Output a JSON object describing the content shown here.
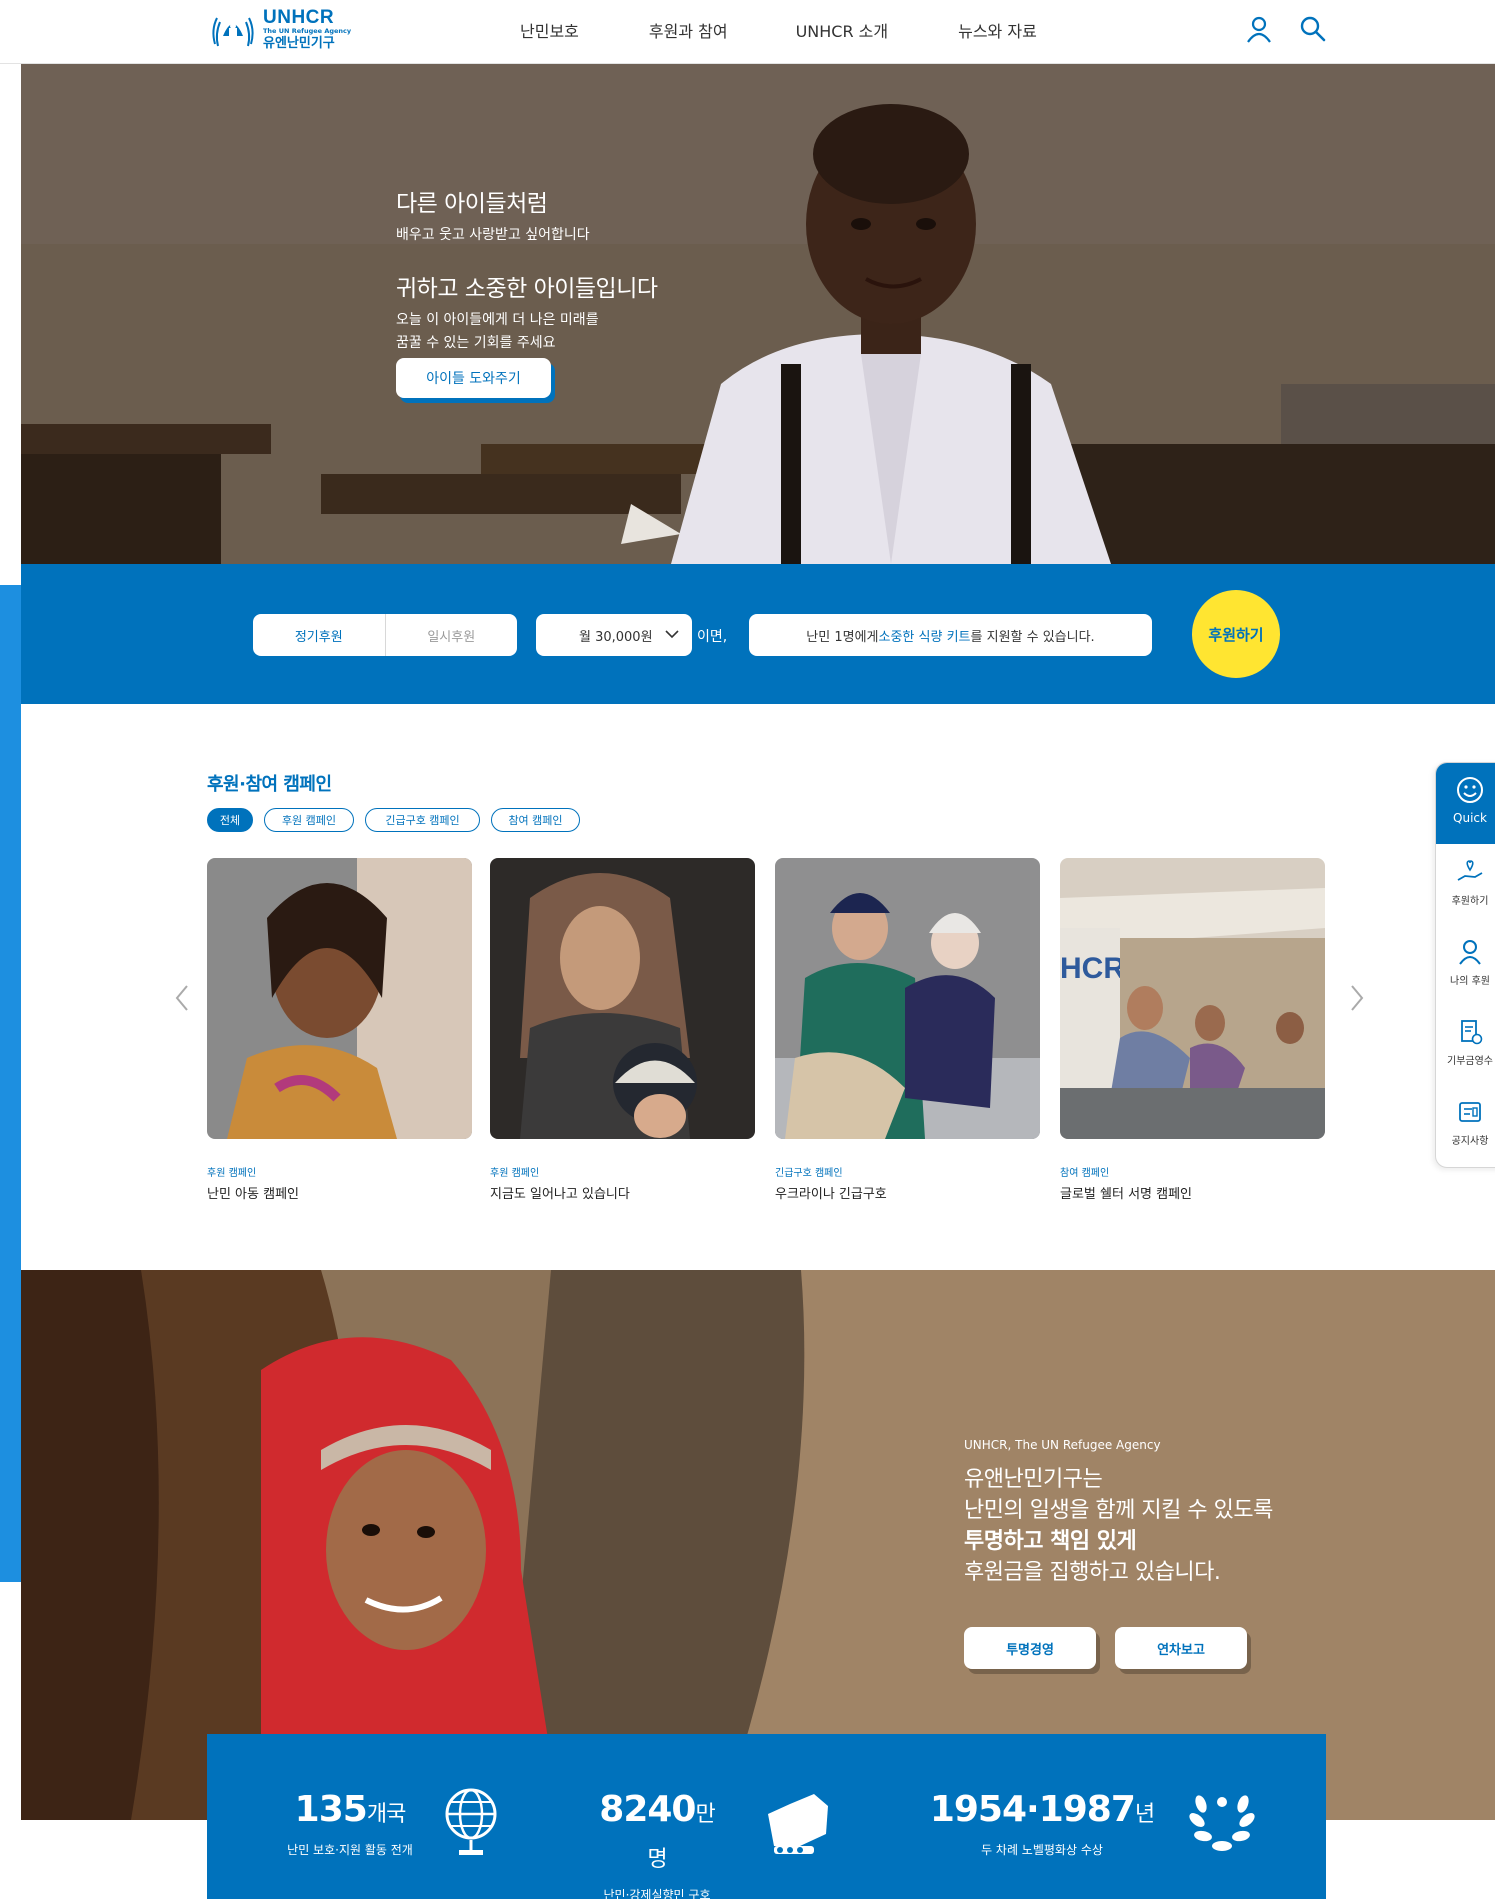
{
  "header": {
    "logo_name": "UNHCR",
    "logo_sub": "The UN Refugee Agency",
    "logo_korean": "유엔난민기구",
    "nav": [
      "난민보호",
      "후원과 참여",
      "UNHCR 소개",
      "뉴스와 자료"
    ],
    "icons": [
      "user-icon",
      "search-icon"
    ]
  },
  "hero": {
    "line1": "다른 아이들처럼",
    "line2": "배우고 웃고 사랑받고 싶어합니다",
    "line3": "귀하고 소중한 아이들입니다",
    "line4": "오늘 이 아이들에게 더 나은 미래를",
    "line5": "꿈꿀 수 있는 기회를 주세요",
    "button": "아이들 도와주기"
  },
  "donate": {
    "tab_regular": "정기후원",
    "tab_once": "일시후원",
    "amount": "월 30,000원",
    "if_text": "이면,",
    "msg_before": "난민 1명에게 ",
    "msg_highlight": "소중한 식량 키트",
    "msg_after": "를 지원할 수 있습니다.",
    "button": "후원하기"
  },
  "campaigns": {
    "title": "후원·참여 캠페인",
    "filters": [
      "전체",
      "후원 캠페인",
      "긴급구호 캠페인",
      "참여 캠페인"
    ],
    "cards": [
      {
        "category": "후원 캠페인",
        "title": "난민 아동 캠페인"
      },
      {
        "category": "후원 캠페인",
        "title": "지금도 일어나고 있습니다"
      },
      {
        "category": "긴급구호 캠페인",
        "title": "우크라이나 긴급구호"
      },
      {
        "category": "참여 캠페인",
        "title": "글로벌 쉘터 서명 캠페인"
      }
    ]
  },
  "quick_menu": {
    "top": "Quick",
    "items": [
      "후원하기",
      "나의 후원",
      "기부금영수",
      "공지사항"
    ]
  },
  "transparency": {
    "small": "UNHCR, The UN Refugee Agency",
    "line1": "유앤난민기구는",
    "line2": "난민의 일생을 함께 지킬 수 있도록",
    "line3": "투명하고 책임 있게",
    "line4": "후원금을 집행하고 있습니다.",
    "btn1": "투명경영",
    "btn2": "연차보고"
  },
  "stats": [
    {
      "num": "135",
      "unit": "개국",
      "label": "난민 보호·지원 활동 전개",
      "icon": "globe-icon"
    },
    {
      "num": "8240",
      "unit": "만명",
      "label": "난민·강제실향민 구호",
      "icon": "fist-icon"
    },
    {
      "num": "1954·1987",
      "unit": "년",
      "label": "두 차례 노벨평화상 수상",
      "icon": "laurel-icon"
    }
  ],
  "colors": {
    "brand": "#0072bc",
    "accent": "#ffe531",
    "stripe": "#1d8fe0"
  }
}
